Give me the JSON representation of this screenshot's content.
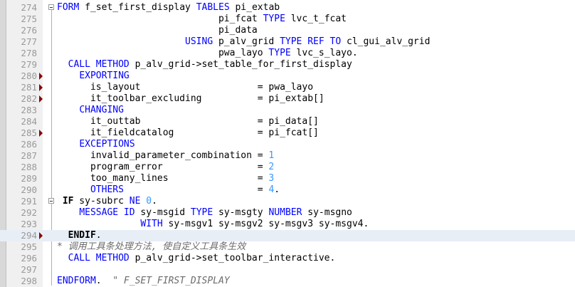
{
  "editor": {
    "lines": [
      {
        "num": "274",
        "bp": false,
        "fold": true,
        "current": false,
        "segs": [
          [
            "kw",
            "FORM"
          ],
          [
            "id",
            " f_set_first_display "
          ],
          [
            "kw",
            "TABLES"
          ],
          [
            "id",
            " pi_extab"
          ]
        ]
      },
      {
        "num": "275",
        "bp": false,
        "fold": false,
        "current": false,
        "segs": [
          [
            "id",
            "                             pi_fcat "
          ],
          [
            "kw",
            "TYPE"
          ],
          [
            "id",
            " lvc_t_fcat"
          ]
        ]
      },
      {
        "num": "276",
        "bp": false,
        "fold": false,
        "current": false,
        "segs": [
          [
            "id",
            "                             pi_data"
          ]
        ]
      },
      {
        "num": "277",
        "bp": false,
        "fold": false,
        "current": false,
        "segs": [
          [
            "id",
            "                       "
          ],
          [
            "kw",
            "USING"
          ],
          [
            "id",
            " p_alv_grid "
          ],
          [
            "kw",
            "TYPE REF TO"
          ],
          [
            "id",
            " cl_gui_alv_grid"
          ]
        ]
      },
      {
        "num": "278",
        "bp": false,
        "fold": false,
        "current": false,
        "segs": [
          [
            "id",
            "                             pwa_layo "
          ],
          [
            "kw",
            "TYPE"
          ],
          [
            "id",
            " lvc_s_layo."
          ]
        ]
      },
      {
        "num": "279",
        "bp": false,
        "fold": false,
        "current": false,
        "segs": [
          [
            "id",
            "  "
          ],
          [
            "kw",
            "CALL METHOD"
          ],
          [
            "id",
            " p_alv_grid->set_table_for_first_display"
          ]
        ]
      },
      {
        "num": "280",
        "bp": true,
        "fold": false,
        "current": false,
        "segs": [
          [
            "id",
            "    "
          ],
          [
            "kw",
            "EXPORTING"
          ]
        ]
      },
      {
        "num": "281",
        "bp": true,
        "fold": false,
        "current": false,
        "segs": [
          [
            "id",
            "      is_layout                     = pwa_layo"
          ]
        ]
      },
      {
        "num": "282",
        "bp": true,
        "fold": false,
        "current": false,
        "segs": [
          [
            "id",
            "      it_toolbar_excluding          = pi_extab[]"
          ]
        ]
      },
      {
        "num": "283",
        "bp": false,
        "fold": false,
        "current": false,
        "segs": [
          [
            "id",
            "    "
          ],
          [
            "kw",
            "CHANGING"
          ]
        ]
      },
      {
        "num": "284",
        "bp": false,
        "fold": false,
        "current": false,
        "segs": [
          [
            "id",
            "      it_outtab                     = pi_data[]"
          ]
        ]
      },
      {
        "num": "285",
        "bp": true,
        "fold": false,
        "current": false,
        "segs": [
          [
            "id",
            "      it_fieldcatalog               = pi_fcat[]"
          ]
        ]
      },
      {
        "num": "286",
        "bp": false,
        "fold": false,
        "current": false,
        "segs": [
          [
            "id",
            "    "
          ],
          [
            "kw",
            "EXCEPTIONS"
          ]
        ]
      },
      {
        "num": "287",
        "bp": false,
        "fold": false,
        "current": false,
        "segs": [
          [
            "id",
            "      invalid_parameter_combination = "
          ],
          [
            "num",
            "1"
          ]
        ]
      },
      {
        "num": "288",
        "bp": false,
        "fold": false,
        "current": false,
        "segs": [
          [
            "id",
            "      program_error                 = "
          ],
          [
            "num",
            "2"
          ]
        ]
      },
      {
        "num": "289",
        "bp": false,
        "fold": false,
        "current": false,
        "segs": [
          [
            "id",
            "      too_many_lines                = "
          ],
          [
            "num",
            "3"
          ]
        ]
      },
      {
        "num": "290",
        "bp": false,
        "fold": false,
        "current": false,
        "segs": [
          [
            "id",
            "      "
          ],
          [
            "kw",
            "OTHERS"
          ],
          [
            "id",
            "                        = "
          ],
          [
            "num",
            "4"
          ],
          [
            "id",
            "."
          ]
        ]
      },
      {
        "num": "291",
        "bp": false,
        "fold": true,
        "current": false,
        "segs": [
          [
            "id",
            " "
          ],
          [
            "kwb",
            "IF"
          ],
          [
            "id",
            " sy-subrc "
          ],
          [
            "kw",
            "NE"
          ],
          [
            "id",
            " "
          ],
          [
            "num",
            "0"
          ],
          [
            "id",
            "."
          ]
        ]
      },
      {
        "num": "292",
        "bp": false,
        "fold": false,
        "current": false,
        "segs": [
          [
            "id",
            "    "
          ],
          [
            "kw",
            "MESSAGE ID"
          ],
          [
            "id",
            " sy-msgid "
          ],
          [
            "kw",
            "TYPE"
          ],
          [
            "id",
            " sy-msgty "
          ],
          [
            "kw",
            "NUMBER"
          ],
          [
            "id",
            " sy-msgno"
          ]
        ]
      },
      {
        "num": "293",
        "bp": false,
        "fold": false,
        "current": false,
        "segs": [
          [
            "id",
            "               "
          ],
          [
            "kw",
            "WITH"
          ],
          [
            "id",
            " sy-msgv1 sy-msgv2 sy-msgv3 sy-msgv4."
          ]
        ]
      },
      {
        "num": "294",
        "bp": true,
        "fold": false,
        "current": true,
        "segs": [
          [
            "id",
            "  "
          ],
          [
            "kwb",
            "ENDIF"
          ],
          [
            "id",
            "."
          ]
        ]
      },
      {
        "num": "295",
        "bp": false,
        "fold": false,
        "current": false,
        "segs": [
          [
            "cm",
            "* 调用工具条处理方法, 使自定义工具条生效"
          ]
        ]
      },
      {
        "num": "296",
        "bp": false,
        "fold": false,
        "current": false,
        "segs": [
          [
            "id",
            "  "
          ],
          [
            "kw",
            "CALL METHOD"
          ],
          [
            "id",
            " p_alv_grid->set_toolbar_interactive."
          ]
        ]
      },
      {
        "num": "297",
        "bp": false,
        "fold": false,
        "current": false,
        "segs": []
      },
      {
        "num": "298",
        "bp": false,
        "fold": false,
        "current": false,
        "segs": [
          [
            "kw",
            "ENDFORM"
          ],
          [
            "id",
            ".  "
          ],
          [
            "cm",
            "\" F_SET_FIRST_DISPLAY"
          ]
        ]
      }
    ]
  }
}
